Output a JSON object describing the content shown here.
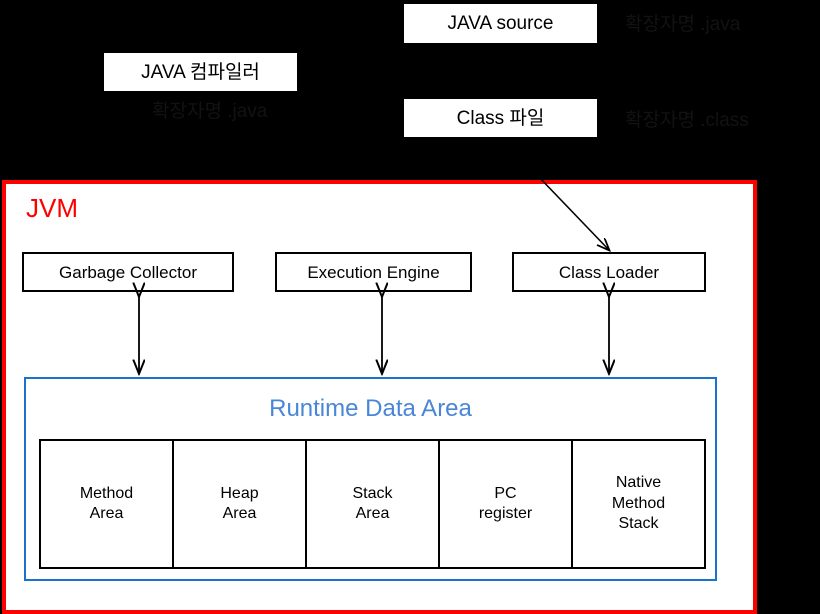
{
  "diagram": {
    "title": "JVM architecture diagram",
    "colors": {
      "background": "#000000",
      "jvm_border": "#ff0000",
      "jvm_title": "#ff0000",
      "runtime_border": "#1a73c8",
      "runtime_title": "#4a86d8",
      "box_border": "#000000",
      "box_fill": "#ffffff"
    }
  },
  "top_area": {
    "compiler_box": "JAVA 컴파일러",
    "compiler_note": "확장자명 .java",
    "source_box": "JAVA source",
    "source_note": "확장자명 .java",
    "class_box": "Class 파일",
    "class_note": "확장자명 .class"
  },
  "jvm": {
    "title": "JVM",
    "components": [
      {
        "label": "Garbage Collector"
      },
      {
        "label": "Execution Engine"
      },
      {
        "label": "Class Loader"
      }
    ],
    "runtime_data_area": {
      "title": "Runtime Data Area",
      "cells": [
        {
          "line1": "Method",
          "line2": "Area",
          "line3": ""
        },
        {
          "line1": "Heap",
          "line2": "Area",
          "line3": ""
        },
        {
          "line1": "Stack",
          "line2": "Area",
          "line3": ""
        },
        {
          "line1": "PC",
          "line2": "register",
          "line3": ""
        },
        {
          "line1": "Native",
          "line2": "Method",
          "line3": "Stack"
        }
      ]
    }
  },
  "connections": [
    {
      "from": "Class 파일",
      "to": "Class Loader",
      "style": "single-arrow-diagonal"
    },
    {
      "from": "Garbage Collector",
      "to": "Runtime Data Area",
      "style": "double-arrow-vertical"
    },
    {
      "from": "Execution Engine",
      "to": "Runtime Data Area",
      "style": "double-arrow-vertical"
    },
    {
      "from": "Class Loader",
      "to": "Runtime Data Area",
      "style": "double-arrow-vertical"
    }
  ]
}
